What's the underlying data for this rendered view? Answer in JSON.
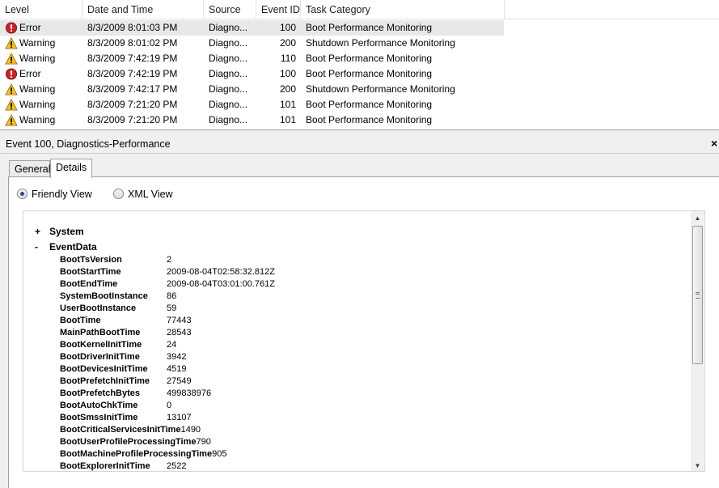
{
  "event_list": {
    "columns": [
      "Level",
      "Date and Time",
      "Source",
      "Event ID",
      "Task Category"
    ],
    "rows": [
      {
        "level": "Error",
        "date": "8/3/2009 8:01:03 PM",
        "source": "Diagno...",
        "event_id": "100",
        "category": "Boot Performance Monitoring"
      },
      {
        "level": "Warning",
        "date": "8/3/2009 8:01:02 PM",
        "source": "Diagno...",
        "event_id": "200",
        "category": "Shutdown Performance Monitoring"
      },
      {
        "level": "Warning",
        "date": "8/3/2009 7:42:19 PM",
        "source": "Diagno...",
        "event_id": "110",
        "category": "Boot Performance Monitoring"
      },
      {
        "level": "Error",
        "date": "8/3/2009 7:42:19 PM",
        "source": "Diagno...",
        "event_id": "100",
        "category": "Boot Performance Monitoring"
      },
      {
        "level": "Warning",
        "date": "8/3/2009 7:42:17 PM",
        "source": "Diagno...",
        "event_id": "200",
        "category": "Shutdown Performance Monitoring"
      },
      {
        "level": "Warning",
        "date": "8/3/2009 7:21:20 PM",
        "source": "Diagno...",
        "event_id": "101",
        "category": "Boot Performance Monitoring"
      },
      {
        "level": "Warning",
        "date": "8/3/2009 7:21:20 PM",
        "source": "Diagno...",
        "event_id": "101",
        "category": "Boot Performance Monitoring"
      }
    ]
  },
  "details": {
    "title": "Event 100, Diagnostics-Performance",
    "close_glyph": "×",
    "tabs": [
      "General",
      "Details"
    ],
    "active_tab": "Details",
    "views": [
      "Friendly View",
      "XML View"
    ],
    "selected_view": "Friendly View",
    "tree": {
      "system": {
        "toggle": "+",
        "label": "System"
      },
      "eventdata": {
        "toggle": "-",
        "label": "EventData"
      },
      "fields": [
        {
          "key": "BootTsVersion",
          "value": "2"
        },
        {
          "key": "BootStartTime",
          "value": "2009-08-04T02:58:32.812Z"
        },
        {
          "key": "BootEndTime",
          "value": "2009-08-04T03:01:00.761Z"
        },
        {
          "key": "SystemBootInstance",
          "value": "86"
        },
        {
          "key": "UserBootInstance",
          "value": "59"
        },
        {
          "key": "BootTime",
          "value": "77443"
        },
        {
          "key": "MainPathBootTime",
          "value": "28543"
        },
        {
          "key": "BootKernelInitTime",
          "value": "24"
        },
        {
          "key": "BootDriverInitTime",
          "value": "3942"
        },
        {
          "key": "BootDevicesInitTime",
          "value": "4519"
        },
        {
          "key": "BootPrefetchInitTime",
          "value": "27549"
        },
        {
          "key": "BootPrefetchBytes",
          "value": "499838976"
        },
        {
          "key": "BootAutoChkTime",
          "value": "0"
        },
        {
          "key": "BootSmssInitTime",
          "value": "13107"
        },
        {
          "key": "BootCriticalServicesInitTime",
          "value": "1490"
        },
        {
          "key": "BootUserProfileProcessingTime",
          "value": "790"
        },
        {
          "key": "BootMachineProfileProcessingTime",
          "value": "905"
        },
        {
          "key": "BootExplorerInitTime",
          "value": "2522"
        }
      ]
    },
    "scrollbar": {
      "up_glyph": "▲",
      "down_glyph": "▼"
    }
  },
  "icons": {
    "error": "error-icon",
    "warning": "warning-icon"
  },
  "colors": {
    "error_red": "#c8262b",
    "warning_yellow": "#f6c323",
    "selected_row": "#e8e8e8"
  }
}
